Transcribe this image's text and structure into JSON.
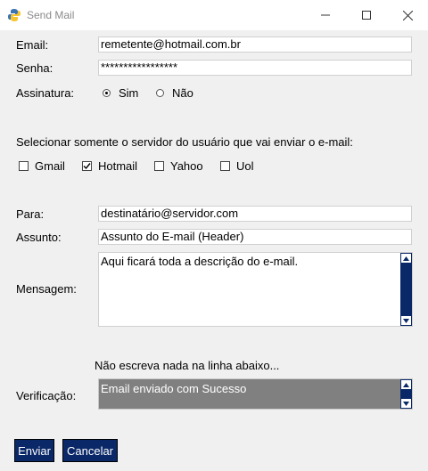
{
  "window": {
    "title": "Send Mail",
    "app_icon": "python-icon",
    "controls": [
      "minimize-icon",
      "maximize-icon",
      "close-icon"
    ]
  },
  "form": {
    "email_label": "Email:",
    "email_value": "remetente@hotmail.com.br",
    "senha_label": "Senha:",
    "senha_value": "*****************",
    "assinatura_label": "Assinatura:",
    "assinatura_options": [
      {
        "label": "Sim",
        "checked": true
      },
      {
        "label": "Não",
        "checked": false
      }
    ],
    "server_prompt": "Selecionar somente o servidor do usuário que vai enviar o e-mail:",
    "servers": [
      {
        "label": "Gmail",
        "checked": false
      },
      {
        "label": "Hotmail",
        "checked": true
      },
      {
        "label": "Yahoo",
        "checked": false
      },
      {
        "label": "Uol",
        "checked": false
      }
    ],
    "para_label": "Para:",
    "para_value": "destinatário@servidor.com",
    "assunto_label": "Assunto:",
    "assunto_value": "Assunto do E-mail (Header)",
    "mensagem_label": "Mensagem:",
    "mensagem_value": "Aqui ficará toda a descrição do e-mail.",
    "warning": "Não escreva nada na linha abaixo...",
    "verificacao_label": "Verificação:",
    "verificacao_value": "Email enviado com Sucesso"
  },
  "buttons": {
    "send": "Enviar",
    "cancel": "Cancelar"
  },
  "colors": {
    "button_bg": "#0a2868",
    "scrollbar": "#0a2868",
    "verification_bg": "#808080"
  }
}
